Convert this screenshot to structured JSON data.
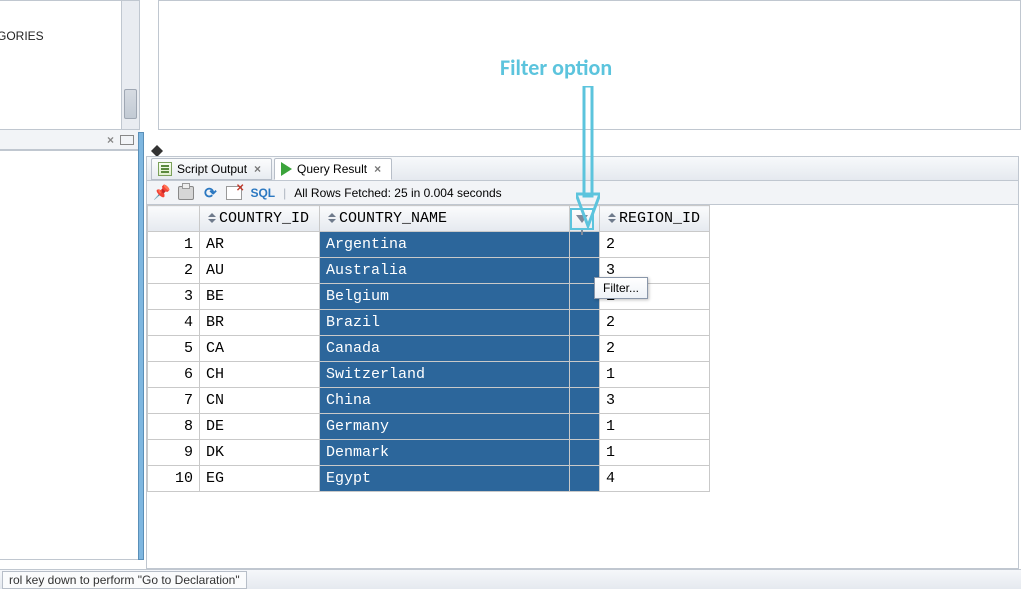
{
  "sidebar": {
    "tree_item": "GORIES"
  },
  "tabs": {
    "script_output": "Script Output",
    "query_result": "Query Result"
  },
  "toolbar": {
    "sql": "SQL",
    "status": "All Rows Fetched: 25 in 0.004 seconds"
  },
  "columns": {
    "country_id": "COUNTRY_ID",
    "country_name": "COUNTRY_NAME",
    "region_id": "REGION_ID"
  },
  "rows": [
    {
      "n": "1",
      "id": "AR",
      "name": "Argentina",
      "region": "2"
    },
    {
      "n": "2",
      "id": "AU",
      "name": "Australia",
      "region": "3"
    },
    {
      "n": "3",
      "id": "BE",
      "name": "Belgium",
      "region": "1"
    },
    {
      "n": "4",
      "id": "BR",
      "name": "Brazil",
      "region": "2"
    },
    {
      "n": "5",
      "id": "CA",
      "name": "Canada",
      "region": "2"
    },
    {
      "n": "6",
      "id": "CH",
      "name": "Switzerland",
      "region": "1"
    },
    {
      "n": "7",
      "id": "CN",
      "name": "China",
      "region": "3"
    },
    {
      "n": "8",
      "id": "DE",
      "name": "Germany",
      "region": "1"
    },
    {
      "n": "9",
      "id": "DK",
      "name": "Denmark",
      "region": "1"
    },
    {
      "n": "10",
      "id": "EG",
      "name": "Egypt",
      "region": "4"
    }
  ],
  "tooltip": {
    "filter": "Filter..."
  },
  "annotation": {
    "label": "Filter option"
  },
  "statusbar": {
    "hint": "rol key down to perform \"Go to Declaration\""
  }
}
